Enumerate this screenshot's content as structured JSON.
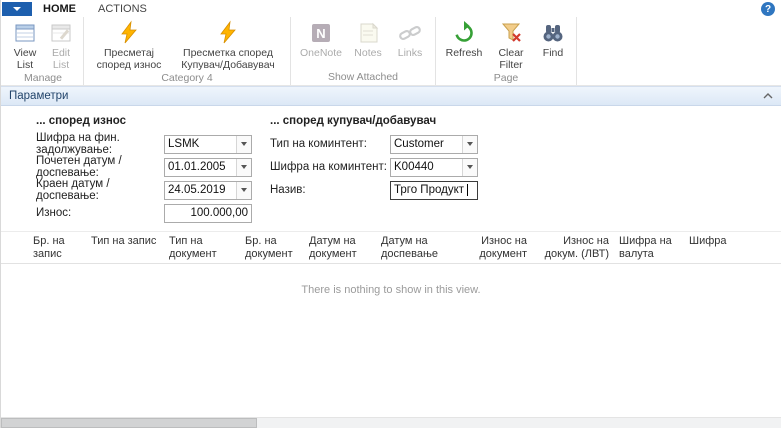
{
  "window": {
    "help": "?"
  },
  "ribbon": {
    "tabs": {
      "home": "HOME",
      "actions": "ACTIONS"
    },
    "groups": {
      "manage": {
        "name": "Manage",
        "view_list": "View List",
        "edit_list": "Edit List"
      },
      "category4": {
        "name": "Category 4",
        "calc_amount": "Пресметај според износ",
        "calc_customer": "Пресметка според Купувач/Добавувач"
      },
      "show_attached": {
        "name": "Show Attached",
        "onenote": "OneNote",
        "notes": "Notes",
        "links": "Links"
      },
      "page": {
        "name": "Page",
        "refresh": "Refresh",
        "clear_filter": "Clear Filter",
        "find": "Find"
      }
    }
  },
  "parameters": {
    "title": "Параметри",
    "amount_group": {
      "title": "... според износ",
      "fin_code_label": "Шифра на фин. задолжување:",
      "fin_code_value": "LSMK",
      "start_date_label": "Почетен датум / доспевање:",
      "start_date_value": "01.01.2005",
      "end_date_label": "Краен датум / доспевање:",
      "end_date_value": "24.05.2019",
      "amount_label": "Износ:",
      "amount_value": "100.000,00"
    },
    "customer_group": {
      "title": "... според купувач/добавувач",
      "type_label": "Тип на коминтент:",
      "type_value": "Customer",
      "code_label": "Шифра на коминтент:",
      "code_value": "K00440",
      "name_label": "Назив:",
      "name_value": "Трго Продукт"
    }
  },
  "table": {
    "columns": [
      "Бр. на запис",
      "Тип на запис",
      "Тип на документ",
      "Бр. на документ",
      "Датум на документ",
      "Датум на доспевање",
      "Износ на документ",
      "Износ на докум. (ЛВТ)",
      "Шифра на валута",
      "Шифра"
    ],
    "empty_message": "There is nothing to show in this view."
  }
}
